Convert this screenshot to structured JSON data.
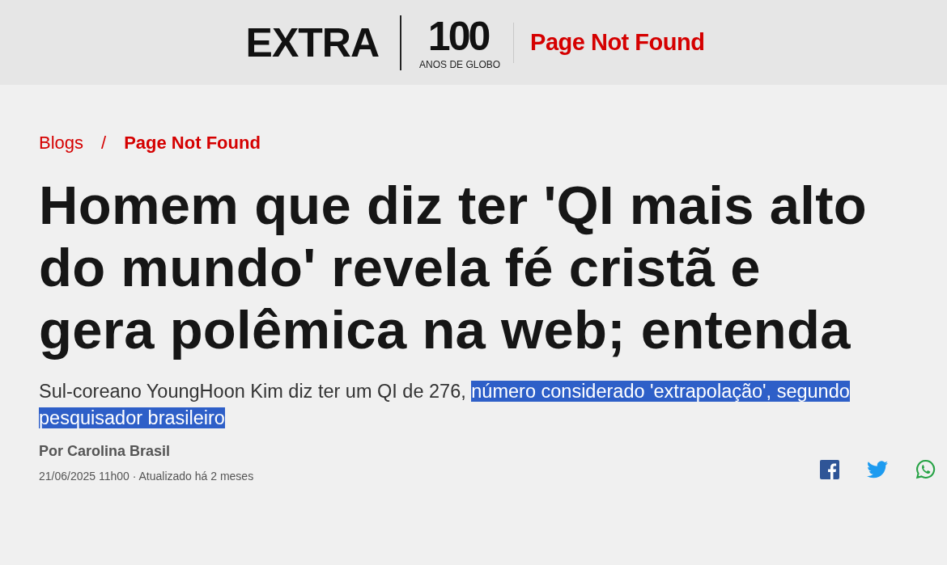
{
  "header": {
    "logo": "EXTRA",
    "anniversary_number": "100",
    "anniversary_caption": "ANOS DE GLOBO",
    "section_title": "Page Not Found"
  },
  "breadcrumb": [
    {
      "label": "Blogs",
      "current": false
    },
    {
      "label": "Page Not Found",
      "current": true
    }
  ],
  "breadcrumb_separator": "/",
  "headline": "Homem que diz ter 'QI mais alto do mundo' revela fé cristã e gera polêmica na web; entenda",
  "subtitle": [
    {
      "text": "Sul-coreano YoungHoon Kim diz ter um QI de 276,",
      "selected": false
    },
    {
      "text": "número considerado 'extrapolação', segundo pesquisador brasileiro",
      "selected": true
    }
  ],
  "byline": "Por Carolina Brasil",
  "dateline": "21/06/2025 11h00 · Atualizado há 2 meses",
  "share": [
    {
      "kind": "facebook"
    },
    {
      "kind": "twitter"
    },
    {
      "kind": "whatsapp"
    }
  ]
}
